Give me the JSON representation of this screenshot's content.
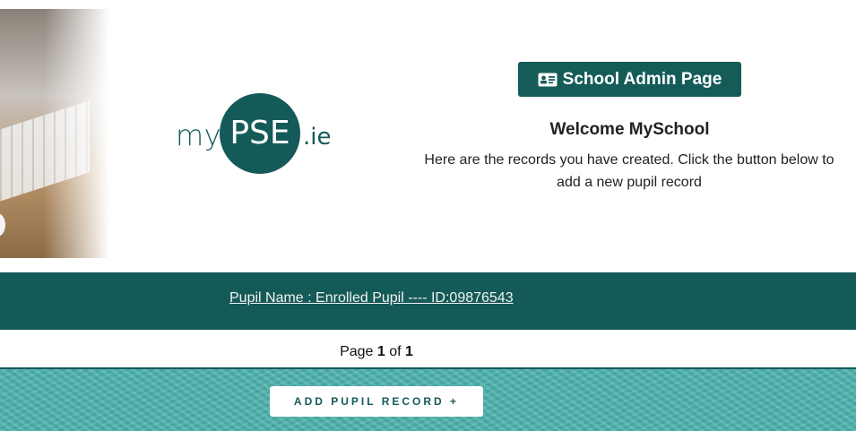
{
  "logo": {
    "prefix": "my",
    "circle": "PSE",
    "suffix": ".ie"
  },
  "header": {
    "admin_button_label": "School Admin Page",
    "admin_button_icon": "id-card-icon",
    "welcome_title": "Welcome MySchool",
    "welcome_text": "Here are the records you have created. Click the button below to add a new pupil record"
  },
  "records": [
    {
      "label": "Pupil Name : Enrolled Pupil ---- ID:09876543"
    }
  ],
  "pagination": {
    "prefix": "Page ",
    "current": "1",
    "of": " of ",
    "total": "1"
  },
  "footer": {
    "add_button_label": "ADD PUPIL RECORD +"
  },
  "colors": {
    "brand": "#145a58",
    "footer_bg": "#4cb2ad"
  }
}
